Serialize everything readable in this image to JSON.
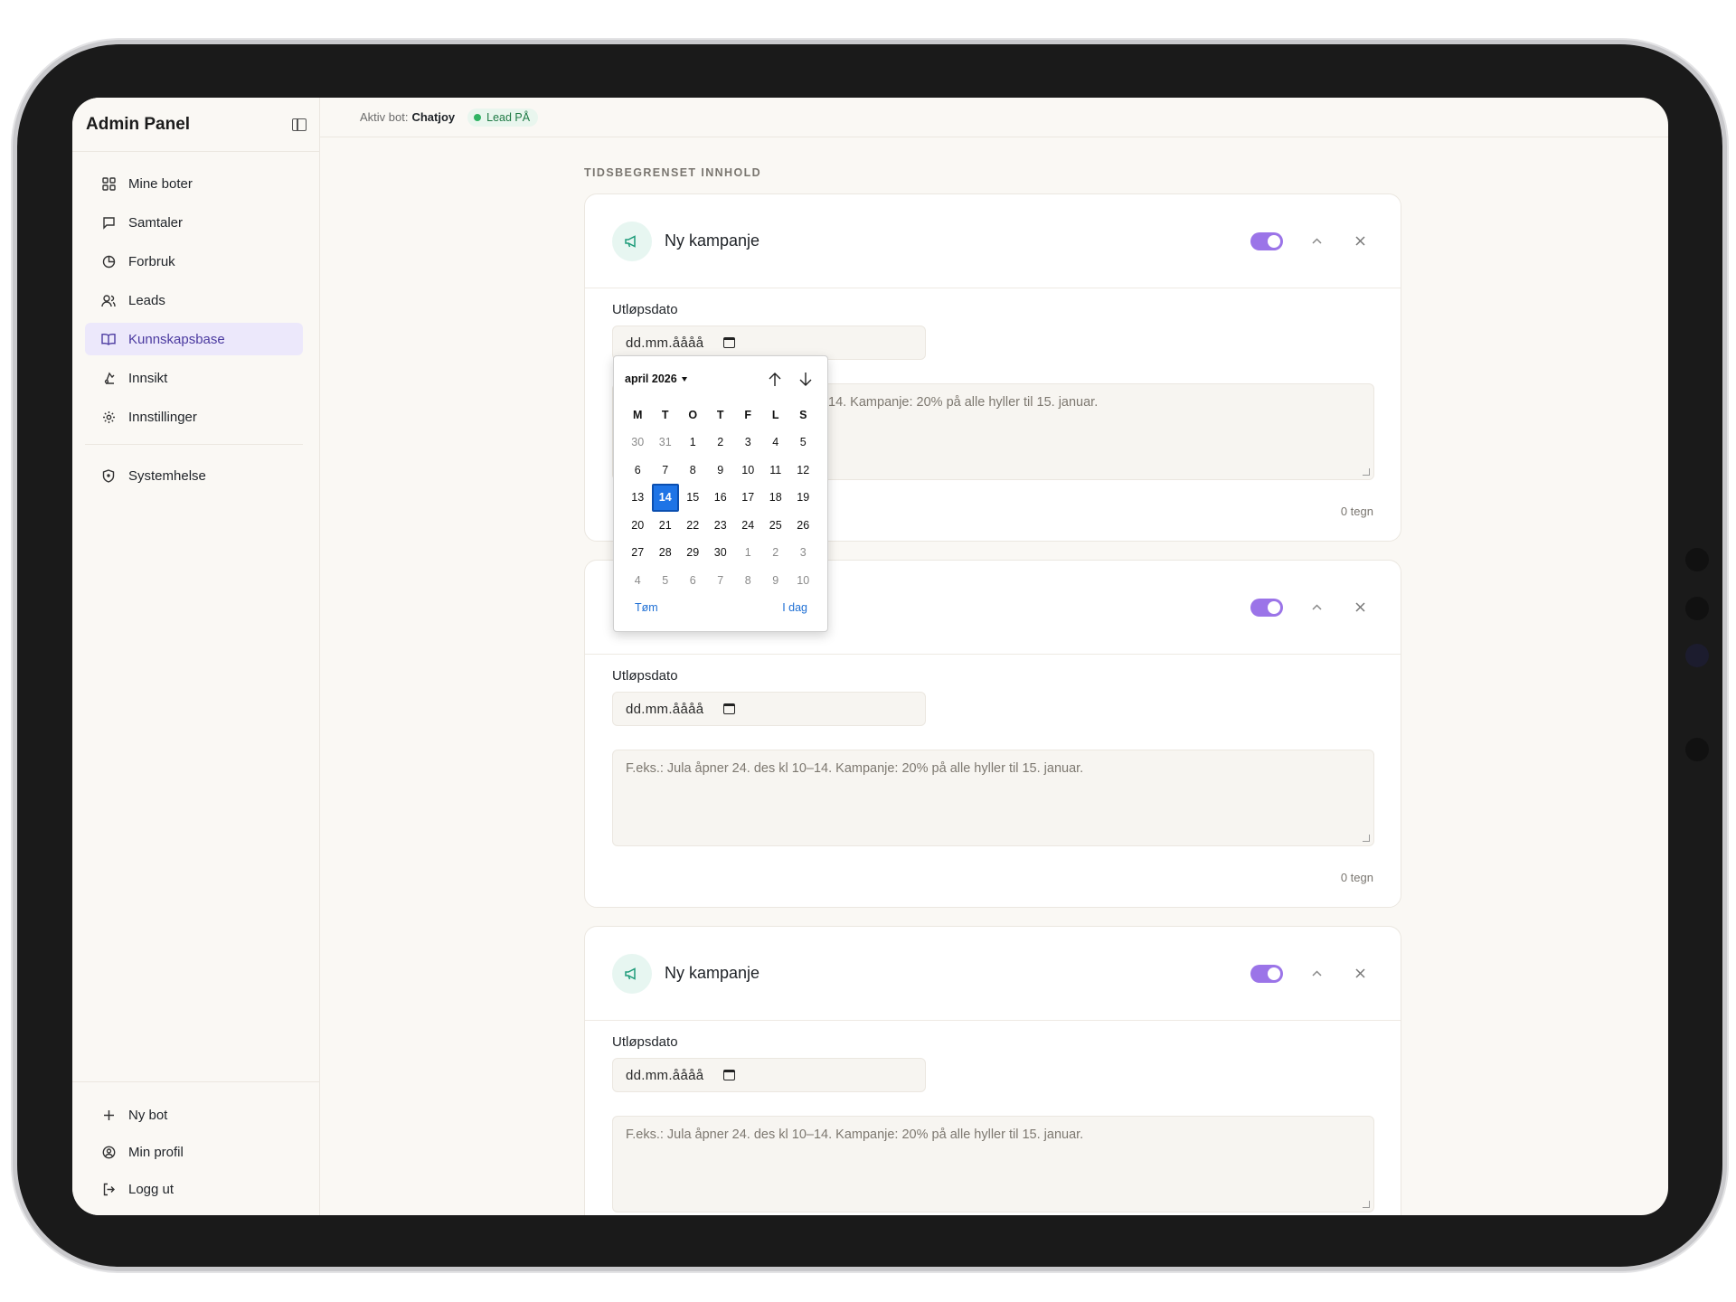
{
  "sidebar": {
    "title": "Admin Panel",
    "items": [
      {
        "label": "Mine boter",
        "icon": "grid-icon"
      },
      {
        "label": "Samtaler",
        "icon": "chat-icon"
      },
      {
        "label": "Forbruk",
        "icon": "pie-chart-icon"
      },
      {
        "label": "Leads",
        "icon": "users-icon"
      },
      {
        "label": "Kunnskapsbase",
        "icon": "book-icon",
        "active": true
      },
      {
        "label": "Innsikt",
        "icon": "insight-icon"
      },
      {
        "label": "Innstillinger",
        "icon": "gear-icon"
      }
    ],
    "system": {
      "label": "Systemhelse",
      "icon": "shield-icon"
    },
    "bottom": [
      {
        "label": "Ny bot",
        "icon": "plus-icon"
      },
      {
        "label": "Min profil",
        "icon": "user-circle-icon"
      },
      {
        "label": "Logg ut",
        "icon": "logout-icon"
      }
    ]
  },
  "topbar": {
    "active_bot_label": "Aktiv bot:",
    "active_bot_name": "Chatjoy",
    "lead_status": "Lead PÅ"
  },
  "main": {
    "section_title": "TIDSBEGRENSET INNHOLD",
    "cards": [
      {
        "title": "Ny kampanje",
        "expiry_label": "Utløpsdato",
        "date_placeholder": "dd.mm.åååå",
        "text_placeholder": "F.eks.: Jula åpner 24. des kl 10–14. Kampanje: 20% på alle hyller til 15. januar.",
        "visible_text": "14. Kampanje: 20% på alle hyller til 15. januar.",
        "char_count": "0 tegn",
        "enabled": true
      },
      {
        "title": "",
        "expiry_label": "Utløpsdato",
        "date_placeholder": "dd.mm.åååå",
        "text_placeholder": "F.eks.: Jula åpner 24. des kl 10–14. Kampanje: 20% på alle hyller til 15. januar.",
        "char_count": "0 tegn",
        "enabled": true
      },
      {
        "title": "Ny kampanje",
        "expiry_label": "Utløpsdato",
        "date_placeholder": "dd.mm.åååå",
        "text_placeholder": "F.eks.: Jula åpner 24. des kl 10–14. Kampanje: 20% på alle hyller til 15. januar.",
        "enabled": true
      }
    ]
  },
  "datepicker": {
    "month_label": "april 2026",
    "weekdays": [
      "M",
      "T",
      "O",
      "T",
      "F",
      "L",
      "S"
    ],
    "weeks": [
      [
        "30",
        "31",
        "1",
        "2",
        "3",
        "4",
        "5"
      ],
      [
        "6",
        "7",
        "8",
        "9",
        "10",
        "11",
        "12"
      ],
      [
        "13",
        "14",
        "15",
        "16",
        "17",
        "18",
        "19"
      ],
      [
        "20",
        "21",
        "22",
        "23",
        "24",
        "25",
        "26"
      ],
      [
        "27",
        "28",
        "29",
        "30",
        "1",
        "2",
        "3"
      ],
      [
        "4",
        "5",
        "6",
        "7",
        "8",
        "9",
        "10"
      ]
    ],
    "selected_day": "14",
    "clear_label": "Tøm",
    "today_label": "I dag"
  },
  "colors": {
    "accent": "#9b74e8",
    "active_nav_bg": "#ece8fb",
    "lead_green": "#2fb463",
    "picker_selected": "#1e74e6"
  }
}
